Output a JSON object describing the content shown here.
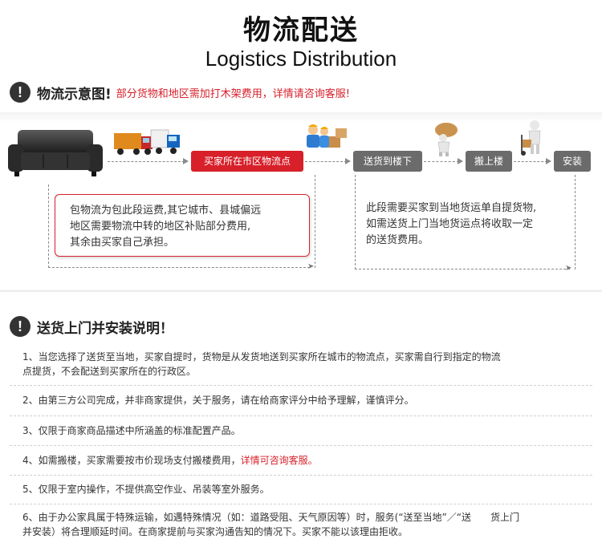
{
  "header": {
    "title_cn": "物流配送",
    "title_en": "Logistics Distribution"
  },
  "section1": {
    "title": "物流示意图!",
    "note": "部分货物和地区需加打木架费用，详情请咨询客服!"
  },
  "flow": {
    "steps": [
      "买家所在市区物流点",
      "送货到楼下",
      "搬上楼",
      "安装"
    ],
    "note_left": [
      "包物流为包此段运费,其它城市、县城偏远",
      "地区需要物流中转的地区补贴部分费用,",
      "其余由买家自己承担。"
    ],
    "note_right": [
      "此段需要买家到当地货运单自提货物,",
      "如需送货上门当地货运点将收取一定",
      "的送货费用。"
    ]
  },
  "section2": {
    "title": "送货上门并安装说明！"
  },
  "items": [
    {
      "line1": "1、当您选择了送货至当地，买家自提时，货物是从发货地送到买家所在城市的物流点，买家需自行到指定的物流",
      "line2": "点提货，不会配送到买家所在的行政区。"
    },
    {
      "text": "2、由第三方公司完成，并非商家提供，关于服务，请在给商家评分中给予理解，谨慎评分。"
    },
    {
      "text": "3、仅限于商家商品描述中所涵盖的标准配置产品。"
    },
    {
      "text": "4、如需搬楼，买家需要按市价现场支付搬楼费用，",
      "highlight": "详情可咨询客服。"
    },
    {
      "text": "5、仅限于室内操作，不提供高空作业、吊装等室外服务。"
    },
    {
      "line1": "6、由于办公家具属于特殊运输，如遇特殊情况（如：道路受阻、天气原因等）时，服务(“送至当地”／“送　　货上门",
      "line2": "并安装）将合理顺延时间。在商家提前与买家沟通告知的情况下。买家不能以该理由拒收。"
    }
  ],
  "colors": {
    "accent": "#d7202a",
    "step_gray": "#6b6b6b",
    "text": "#333333"
  },
  "icons": [
    "exclamation-icon",
    "sofa-icon",
    "trucks-icon",
    "workers-boxes-icon",
    "porter-icon",
    "hand-truck-icon"
  ]
}
